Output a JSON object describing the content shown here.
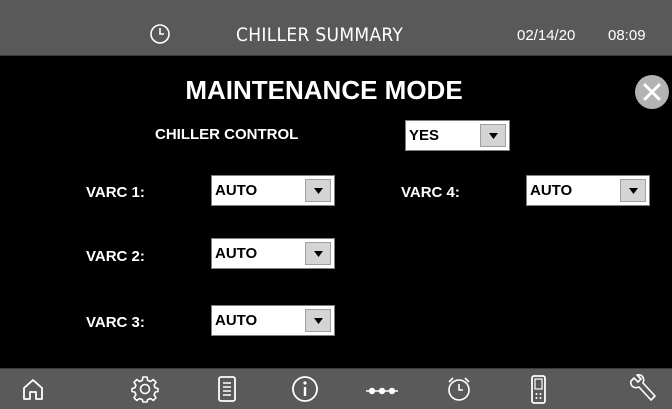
{
  "header": {
    "clock_icon": "clock-icon",
    "title": "CHILLER SUMMARY",
    "date": "02/14/20",
    "time": "08:09"
  },
  "main": {
    "title": "MAINTENANCE MODE",
    "close_icon": "close-icon",
    "chiller_control": {
      "label": "CHILLER CONTROL",
      "value": "YES"
    },
    "varcs": [
      {
        "label": "VARC 1:",
        "value": "AUTO"
      },
      {
        "label": "VARC 2:",
        "value": "AUTO"
      },
      {
        "label": "VARC 3:",
        "value": "AUTO"
      },
      {
        "label": "VARC 4:",
        "value": "AUTO"
      }
    ]
  },
  "footer": {
    "nav_icons": [
      "home-icon",
      "gear-icon",
      "document-icon",
      "info-icon",
      "more-icon",
      "alarm-clock-icon",
      "remote-icon",
      "wrench-icon"
    ]
  },
  "colors": {
    "background": "#000000",
    "bar": "#595959",
    "text": "#ffffff",
    "dropdown_bg": "#ffffff",
    "dropdown_button": "#d4d4d4"
  }
}
